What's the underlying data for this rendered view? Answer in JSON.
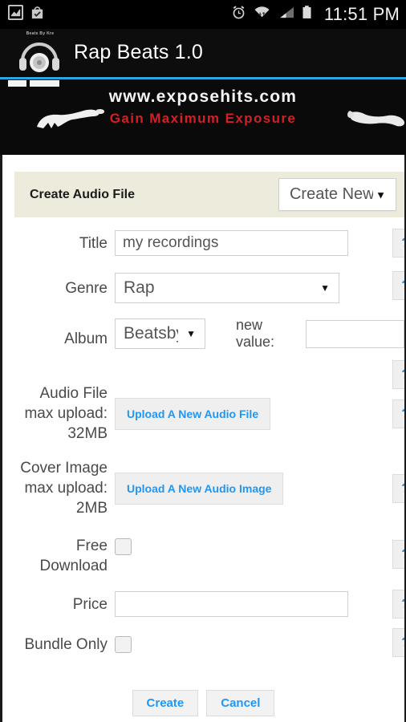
{
  "statusbar": {
    "time": "11:51 PM",
    "icons": [
      "screenshot-icon",
      "play-store-bag-icon",
      "alarm-icon",
      "wifi-icon",
      "cell-signal-icon",
      "battery-icon"
    ]
  },
  "actionbar": {
    "app_title": "Rap Beats 1.0",
    "logo_sub": "Beats By Kre"
  },
  "banner": {
    "url": "www.exposehits.com",
    "tagline": "Gain Maximum Exposure"
  },
  "panel": {
    "title": "Create Audio File",
    "mode_select": "Create New"
  },
  "form": {
    "title": {
      "label": "Title",
      "value": "my recordings"
    },
    "genre": {
      "label": "Genre",
      "value": "Rap"
    },
    "album": {
      "label": "Album",
      "value": "Beatsby",
      "new_value_label": "new value:",
      "new_value": ""
    },
    "audio_file": {
      "label": "Audio File\nmax upload:\n32MB",
      "line1": "Audio File",
      "line2": "max upload:",
      "line3": "32MB",
      "button": "Upload A New Audio File"
    },
    "cover_image": {
      "line1": "Cover Image",
      "line2": "max upload:",
      "line3": "2MB",
      "button": "Upload A New Audio Image"
    },
    "free_download": {
      "line1": "Free",
      "line2": "Download",
      "checked": false
    },
    "price": {
      "label": "Price",
      "value": ""
    },
    "bundle_only": {
      "label": "Bundle Only",
      "checked": false
    },
    "help_label": "?"
  },
  "actions": {
    "create": "Create",
    "cancel": "Cancel"
  }
}
